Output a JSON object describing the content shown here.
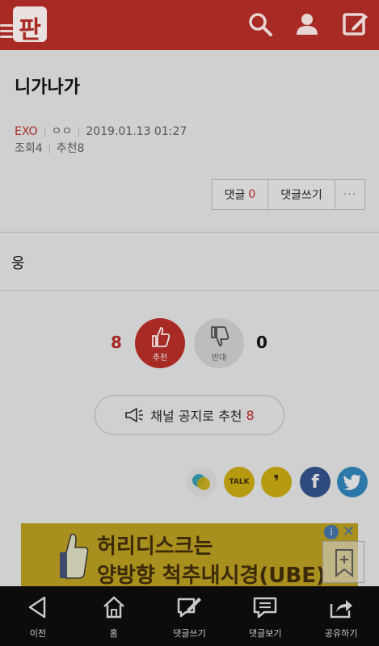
{
  "header": {
    "logo_text": "판",
    "icons": [
      "menu-icon",
      "search-icon",
      "user-icon",
      "write-icon"
    ]
  },
  "post": {
    "title": "니가나가",
    "board": "EXO",
    "author": "ㅇㅇ",
    "date": "2019.01.13 01:27",
    "views_label": "조회",
    "views": "4",
    "recommend_label": "추천",
    "recommend": "8",
    "body": "웅"
  },
  "actions": {
    "comment_label": "댓글",
    "comment_count": "0",
    "write_comment_label": "댓글쓰기",
    "more_label": "···"
  },
  "vote": {
    "up_count": "8",
    "up_label": "추천",
    "down_label": "반대",
    "down_count": "0"
  },
  "notice": {
    "label": "채널 공지로 추천",
    "count": "8"
  },
  "share": {
    "kakaotalk_label": "TALK",
    "kakaostory_label": "❜",
    "facebook_label": "f"
  },
  "ad": {
    "line1": "허리디스크는",
    "line2": "양방향 척추내시경(UBE)",
    "info": "i",
    "close": "✕"
  },
  "bottom_nav": [
    {
      "label": "이전",
      "icon": "back-icon"
    },
    {
      "label": "홈",
      "icon": "home-icon"
    },
    {
      "label": "댓글쓰기",
      "icon": "write-comment-icon"
    },
    {
      "label": "댓글보기",
      "icon": "view-comment-icon"
    },
    {
      "label": "공유하기",
      "icon": "share-icon"
    }
  ],
  "colors": {
    "brand": "#a72a24",
    "navbar": "#0c0c0c",
    "facebook": "#2f4a7c",
    "twitter": "#2c78a8",
    "kakao": "#c8aa10"
  }
}
